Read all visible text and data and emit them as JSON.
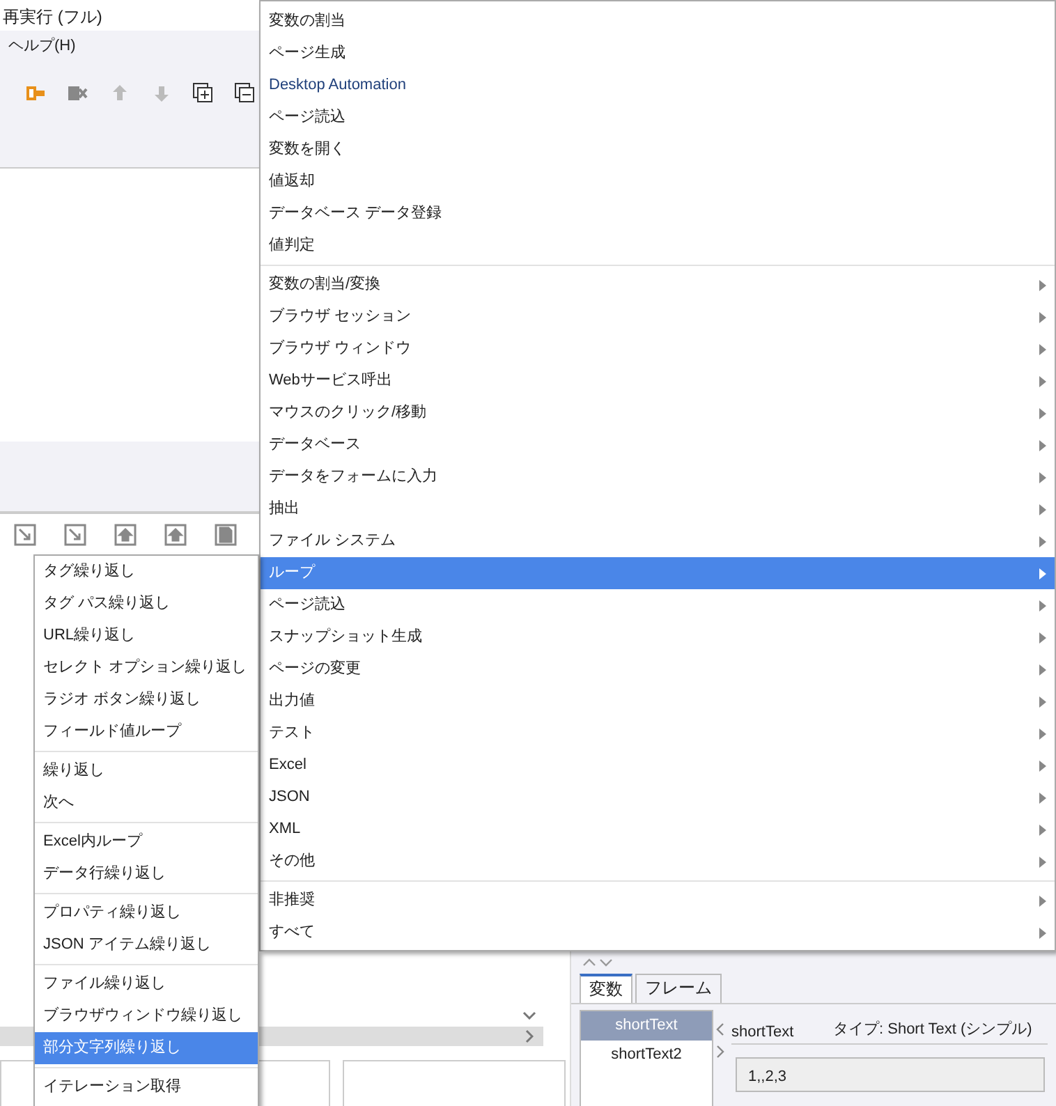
{
  "window": {
    "title": "再実行 (フル)"
  },
  "menubar": [
    {
      "label": "ヘルプ(H)"
    }
  ],
  "context_menu": {
    "groups": [
      [
        {
          "label": "変数の割当",
          "submenu": false,
          "selected": false,
          "kind": "plain"
        },
        {
          "label": "ページ生成",
          "submenu": false,
          "selected": false,
          "kind": "plain"
        },
        {
          "label": "Desktop Automation",
          "submenu": false,
          "selected": false,
          "kind": "link"
        },
        {
          "label": "ページ読込",
          "submenu": false,
          "selected": false,
          "kind": "plain"
        },
        {
          "label": "変数を開く",
          "submenu": false,
          "selected": false,
          "kind": "plain"
        },
        {
          "label": "値返却",
          "submenu": false,
          "selected": false,
          "kind": "plain"
        },
        {
          "label": "データベース データ登録",
          "submenu": false,
          "selected": false,
          "kind": "plain"
        },
        {
          "label": "値判定",
          "submenu": false,
          "selected": false,
          "kind": "plain"
        }
      ],
      [
        {
          "label": "変数の割当/変換",
          "submenu": true,
          "selected": false,
          "kind": "plain"
        },
        {
          "label": "ブラウザ セッション",
          "submenu": true,
          "selected": false,
          "kind": "plain"
        },
        {
          "label": "ブラウザ ウィンドウ",
          "submenu": true,
          "selected": false,
          "kind": "plain"
        },
        {
          "label": "Webサービス呼出",
          "submenu": true,
          "selected": false,
          "kind": "plain"
        },
        {
          "label": "マウスのクリック/移動",
          "submenu": true,
          "selected": false,
          "kind": "plain"
        },
        {
          "label": "データベース",
          "submenu": true,
          "selected": false,
          "kind": "plain"
        },
        {
          "label": "データをフォームに入力",
          "submenu": true,
          "selected": false,
          "kind": "plain"
        },
        {
          "label": "抽出",
          "submenu": true,
          "selected": false,
          "kind": "plain"
        },
        {
          "label": "ファイル システム",
          "submenu": true,
          "selected": false,
          "kind": "plain"
        },
        {
          "label": "ループ",
          "submenu": true,
          "selected": true,
          "kind": "plain"
        },
        {
          "label": "ページ読込",
          "submenu": true,
          "selected": false,
          "kind": "plain"
        },
        {
          "label": "スナップショット生成",
          "submenu": true,
          "selected": false,
          "kind": "plain"
        },
        {
          "label": "ページの変更",
          "submenu": true,
          "selected": false,
          "kind": "plain"
        },
        {
          "label": "出力値",
          "submenu": true,
          "selected": false,
          "kind": "plain"
        },
        {
          "label": "テスト",
          "submenu": true,
          "selected": false,
          "kind": "plain"
        },
        {
          "label": "Excel",
          "submenu": true,
          "selected": false,
          "kind": "plain"
        },
        {
          "label": "JSON",
          "submenu": true,
          "selected": false,
          "kind": "plain"
        },
        {
          "label": "XML",
          "submenu": true,
          "selected": false,
          "kind": "plain"
        },
        {
          "label": "その他",
          "submenu": true,
          "selected": false,
          "kind": "plain"
        }
      ],
      [
        {
          "label": "非推奨",
          "submenu": true,
          "selected": false,
          "kind": "plain"
        },
        {
          "label": "すべて",
          "submenu": true,
          "selected": false,
          "kind": "plain"
        }
      ]
    ]
  },
  "submenu": {
    "groups": [
      [
        {
          "label": "タグ繰り返し",
          "selected": false
        },
        {
          "label": "タグ パス繰り返し",
          "selected": false
        },
        {
          "label": "URL繰り返し",
          "selected": false
        },
        {
          "label": "セレクト オプション繰り返し",
          "selected": false
        },
        {
          "label": "ラジオ ボタン繰り返し",
          "selected": false
        },
        {
          "label": "フィールド値ループ",
          "selected": false
        }
      ],
      [
        {
          "label": "繰り返し",
          "selected": false
        },
        {
          "label": "次へ",
          "selected": false
        }
      ],
      [
        {
          "label": "Excel内ループ",
          "selected": false
        },
        {
          "label": "データ行繰り返し",
          "selected": false
        }
      ],
      [
        {
          "label": "プロパティ繰り返し",
          "selected": false
        },
        {
          "label": "JSON アイテム繰り返し",
          "selected": false
        }
      ],
      [
        {
          "label": "ファイル繰り返し",
          "selected": false
        },
        {
          "label": "ブラウザウィンドウ繰り返し",
          "selected": false
        },
        {
          "label": "部分文字列繰り返し",
          "selected": true
        }
      ],
      [
        {
          "label": "イテレーション取得",
          "selected": false
        }
      ]
    ]
  },
  "variables_panel": {
    "tabs": [
      {
        "label": "変数",
        "selected": true
      },
      {
        "label": "フレーム",
        "selected": false
      }
    ],
    "variables": [
      {
        "label": "shortText",
        "selected": true
      },
      {
        "label": "shortText2",
        "selected": false
      }
    ],
    "name": "shortText",
    "type": "タイプ: Short Text (シンプル)",
    "value": "1,,2,3"
  }
}
